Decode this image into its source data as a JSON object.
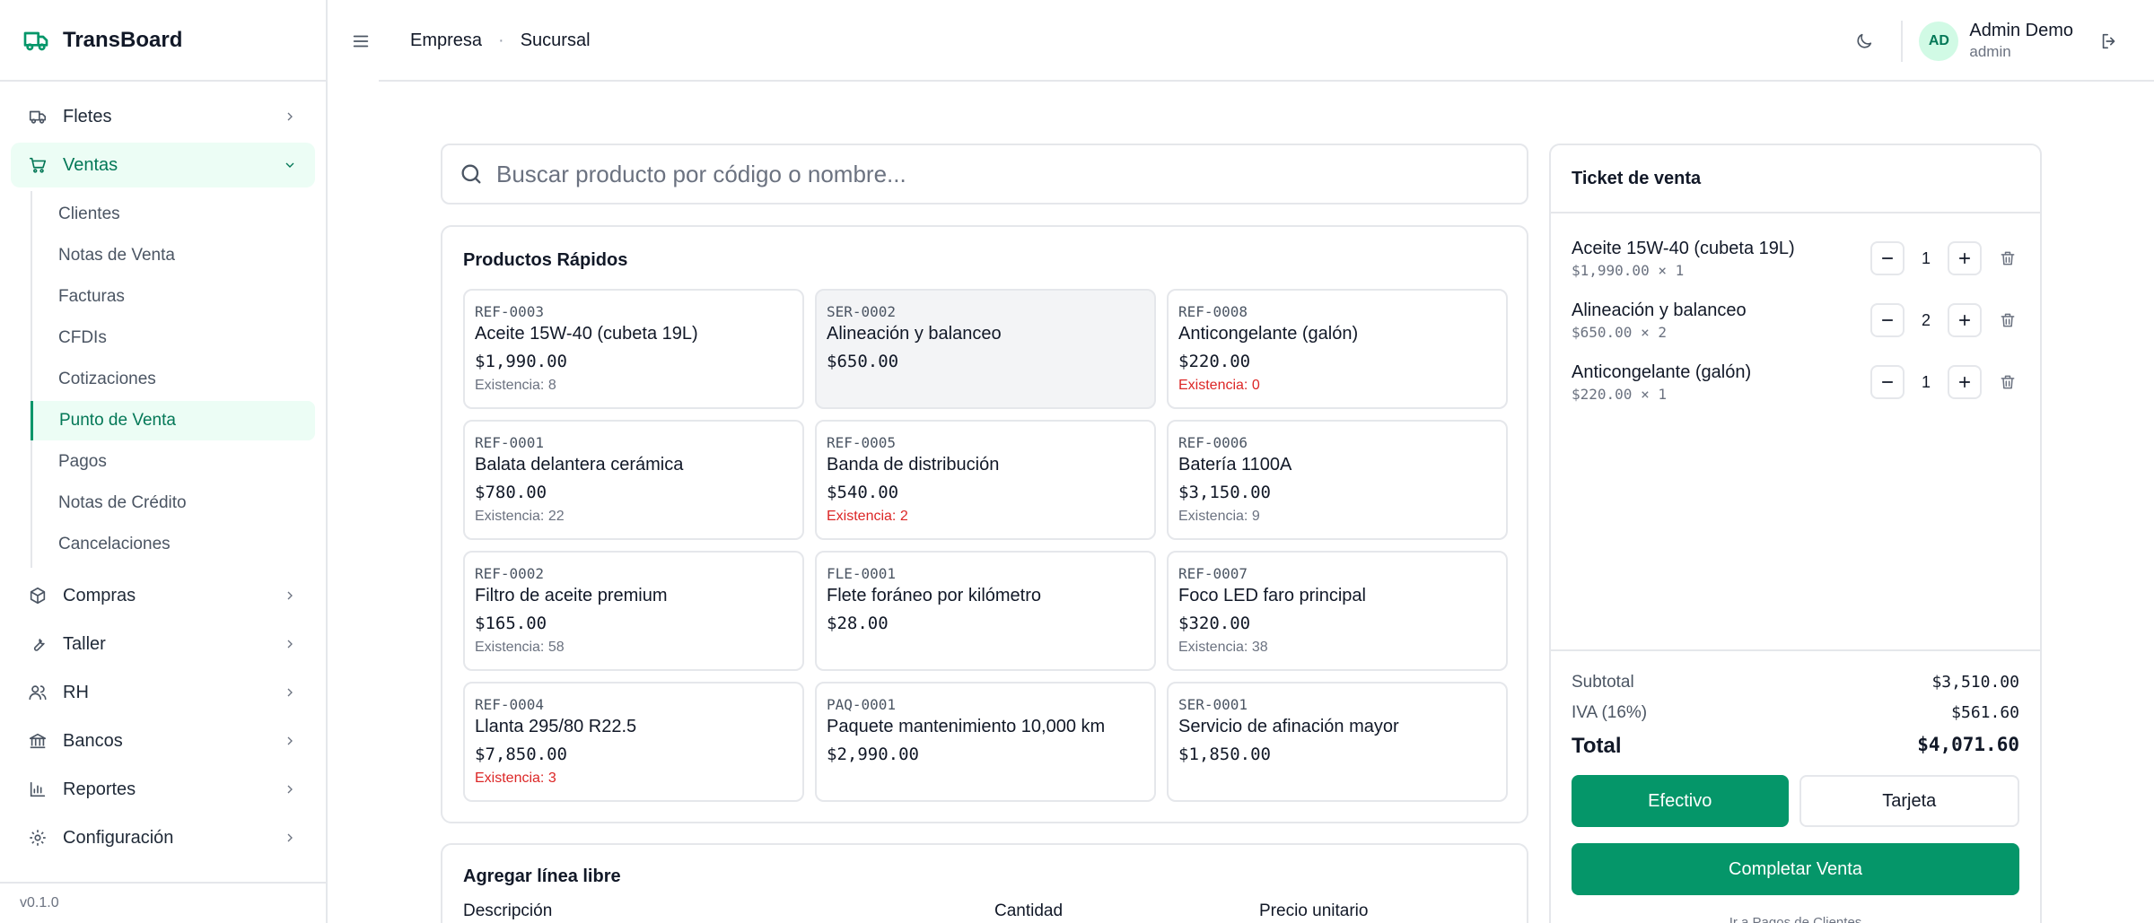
{
  "app": {
    "name": "TransBoard",
    "version": "v0.1.0"
  },
  "sidebar": {
    "items": [
      {
        "label": "Fletes",
        "icon": "truck-icon"
      },
      {
        "label": "Ventas",
        "icon": "cart-icon",
        "open": true
      },
      {
        "label": "Compras",
        "icon": "package-icon"
      },
      {
        "label": "Taller",
        "icon": "wrench-icon"
      },
      {
        "label": "RH",
        "icon": "users-icon"
      },
      {
        "label": "Bancos",
        "icon": "bank-icon"
      },
      {
        "label": "Reportes",
        "icon": "chart-icon"
      },
      {
        "label": "Configuración",
        "icon": "gear-icon"
      }
    ],
    "ventas_sub": [
      "Clientes",
      "Notas de Venta",
      "Facturas",
      "CFDIs",
      "Cotizaciones",
      "Punto de Venta",
      "Pagos",
      "Notas de Crédito",
      "Cancelaciones"
    ],
    "active_sub": "Punto de Venta"
  },
  "header": {
    "breadcrumb": [
      "Empresa",
      "Sucursal"
    ],
    "separator": "·",
    "user": {
      "initials": "AD",
      "name": "Admin Demo",
      "role": "admin"
    }
  },
  "search": {
    "placeholder": "Buscar producto por código o nombre..."
  },
  "quick": {
    "title": "Productos Rápidos",
    "stock_prefix": "Existencia: ",
    "products": [
      {
        "code": "REF-0003",
        "name": "Aceite 15W-40 (cubeta 19L)",
        "price": "$1,990.00",
        "stock": "8",
        "low": false
      },
      {
        "code": "SER-0002",
        "name": "Alineación y balanceo",
        "price": "$650.00",
        "stock": null,
        "low": false
      },
      {
        "code": "REF-0008",
        "name": "Anticongelante (galón)",
        "price": "$220.00",
        "stock": "0",
        "low": true
      },
      {
        "code": "REF-0001",
        "name": "Balata delantera cerámica",
        "price": "$780.00",
        "stock": "22",
        "low": false
      },
      {
        "code": "REF-0005",
        "name": "Banda de distribución",
        "price": "$540.00",
        "stock": "2",
        "low": true
      },
      {
        "code": "REF-0006",
        "name": "Batería 1100A",
        "price": "$3,150.00",
        "stock": "9",
        "low": false
      },
      {
        "code": "REF-0002",
        "name": "Filtro de aceite premium",
        "price": "$165.00",
        "stock": "58",
        "low": false
      },
      {
        "code": "FLE-0001",
        "name": "Flete foráneo por kilómetro",
        "price": "$28.00",
        "stock": null,
        "low": false
      },
      {
        "code": "REF-0007",
        "name": "Foco LED faro principal",
        "price": "$320.00",
        "stock": "38",
        "low": false
      },
      {
        "code": "REF-0004",
        "name": "Llanta 295/80 R22.5",
        "price": "$7,850.00",
        "stock": "3",
        "low": true
      },
      {
        "code": "PAQ-0001",
        "name": "Paquete mantenimiento 10,000 km",
        "price": "$2,990.00",
        "stock": null,
        "low": false
      },
      {
        "code": "SER-0001",
        "name": "Servicio de afinación mayor",
        "price": "$1,850.00",
        "stock": null,
        "low": false
      }
    ]
  },
  "freeline": {
    "title": "Agregar línea libre",
    "labels": {
      "description": "Descripción",
      "quantity": "Cantidad",
      "unit_price": "Precio unitario"
    }
  },
  "ticket": {
    "title": "Ticket de venta",
    "lines": [
      {
        "name": "Aceite 15W-40 (cubeta 19L)",
        "detail": "$1,990.00 × 1",
        "qty": "1"
      },
      {
        "name": "Alineación y balanceo",
        "detail": "$650.00 × 2",
        "qty": "2"
      },
      {
        "name": "Anticongelante (galón)",
        "detail": "$220.00 × 1",
        "qty": "1"
      }
    ],
    "subtotal_label": "Subtotal",
    "subtotal": "$3,510.00",
    "iva_label": "IVA (16%)",
    "iva": "$561.60",
    "total_label": "Total",
    "total": "$4,071.60",
    "cash_label": "Efectivo",
    "card_label": "Tarjeta",
    "complete_label": "Completar Venta",
    "note": "Ir a Pagos de Clientes"
  },
  "colors": {
    "accent": "#059669",
    "accent_light": "#ecfdf5",
    "danger": "#dc2626",
    "border": "#e5e7eb"
  }
}
